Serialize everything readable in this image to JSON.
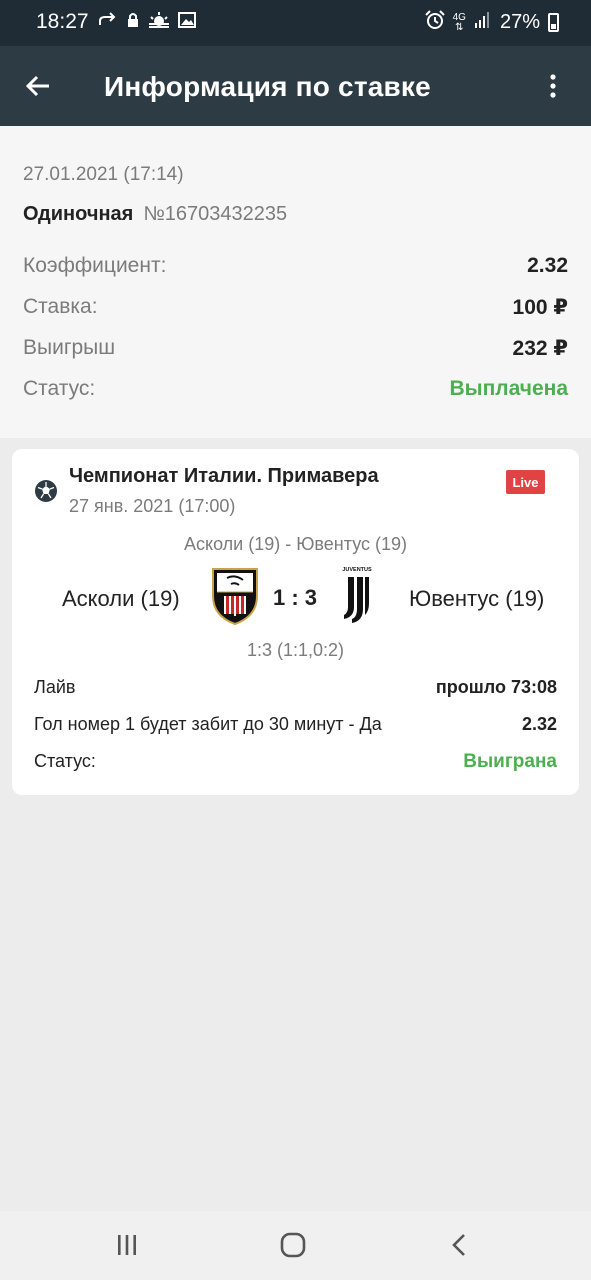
{
  "status_bar": {
    "time": "18:27",
    "battery": "27%",
    "network": "4G",
    "left_icons": [
      "share-arrow-icon",
      "lock-icon",
      "weather-icon",
      "image-icon"
    ],
    "right_icons": [
      "alarm-icon",
      "network-4g-icon",
      "signal-icon",
      "battery-icon"
    ]
  },
  "app_bar": {
    "title": "Информация по ставке",
    "back_icon": "arrow-left-icon",
    "menu_icon": "more-vert-icon"
  },
  "summary": {
    "date": "27.01.2021 (17:14)",
    "bet_type": "Одиночная",
    "bet_number": "№16703432235",
    "rows": [
      {
        "label": "Коэффициент:",
        "value": "2.32"
      },
      {
        "label": "Ставка:",
        "value": "100 ₽"
      },
      {
        "label": "Выигрыш",
        "value": "232 ₽"
      },
      {
        "label": "Статус:",
        "value": "Выплачена",
        "color": "#4caf50"
      }
    ]
  },
  "event": {
    "sport_icon": "soccer-ball-icon",
    "league": "Чемпионат Италии. Примавера",
    "date": "27 янв. 2021 (17:00)",
    "live_badge": "Live",
    "live_color": "#e04343",
    "match_title": "Асколи (19) - Ювентус (19)",
    "home_team": "Асколи (19)",
    "away_team": "Ювентус (19)",
    "score": "1 : 3",
    "score_detail": "1:3 (1:1,0:2)",
    "away_logo_text": "JUVENTUS",
    "rows": [
      {
        "label": "Лайв",
        "value": "прошло 73:08"
      },
      {
        "label": "Гол номер 1 будет забит до 30 минут - Да",
        "value": "2.32"
      },
      {
        "label": "Статус:",
        "value": "Выиграна",
        "color": "#4caf50"
      }
    ]
  },
  "nav_bar": {
    "icons": [
      "recent-apps-icon",
      "home-icon",
      "back-icon"
    ]
  }
}
